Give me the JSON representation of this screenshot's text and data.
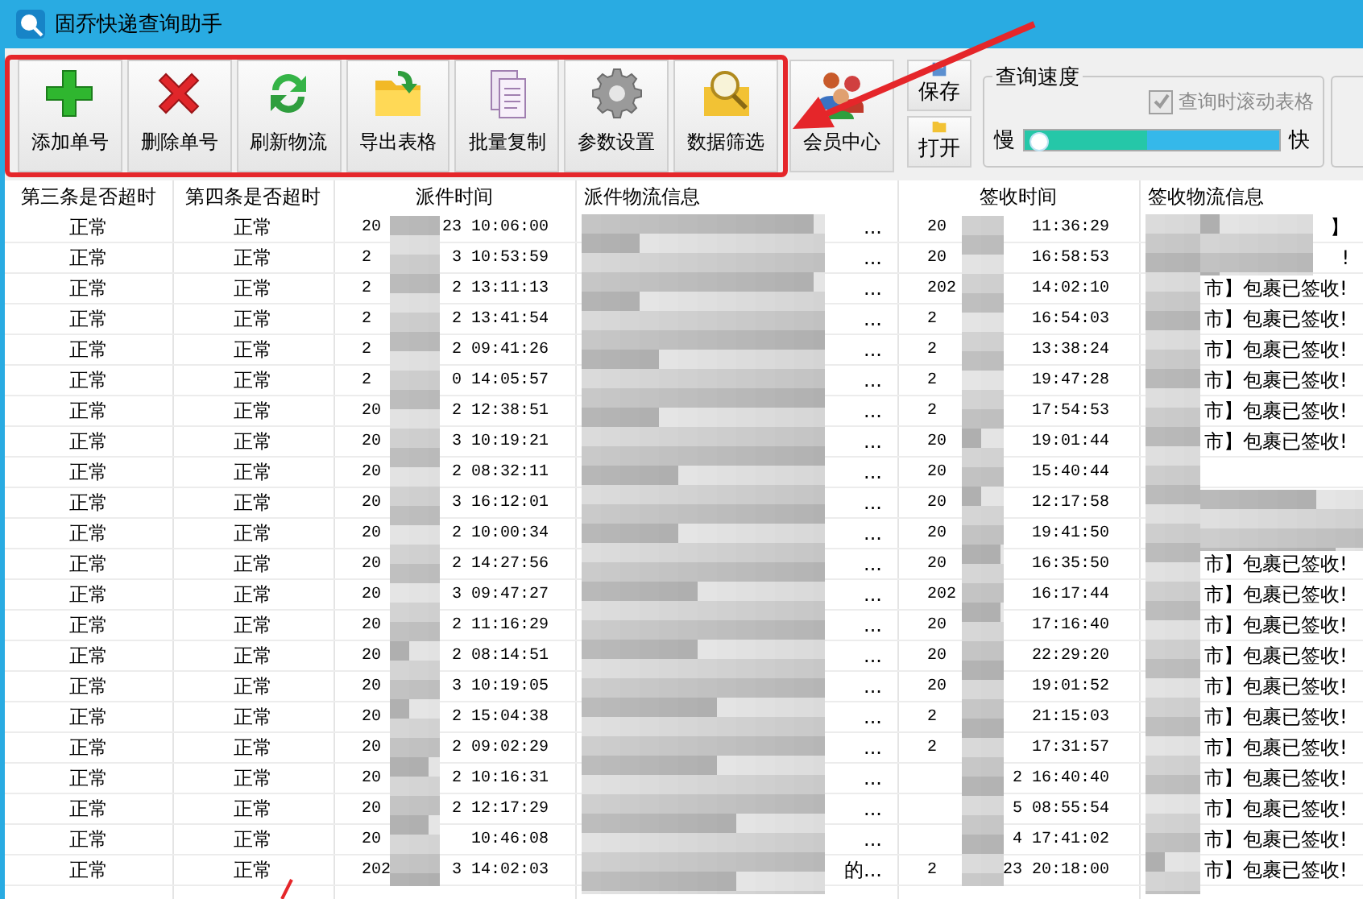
{
  "window": {
    "title": "固乔快递查询助手"
  },
  "toolbar": {
    "buttons": [
      {
        "label": "添加单号",
        "kind": "add"
      },
      {
        "label": "删除单号",
        "kind": "delete"
      },
      {
        "label": "刷新物流",
        "kind": "refresh"
      },
      {
        "label": "导出表格",
        "kind": "export"
      },
      {
        "label": "批量复制",
        "kind": "copy"
      },
      {
        "label": "参数设置",
        "kind": "settings"
      },
      {
        "label": "数据筛选",
        "kind": "filter"
      },
      {
        "label": "会员中心",
        "kind": "members"
      }
    ],
    "small_buttons": [
      {
        "label": "保存",
        "kind": "save"
      },
      {
        "label": "打开",
        "kind": "open"
      }
    ]
  },
  "speed_group": {
    "title": "查询速度",
    "scroll_checkbox": {
      "label": "查询时滚动表格",
      "checked": true,
      "disabled": true
    },
    "slow_label": "慢",
    "fast_label": "快",
    "slider": {
      "level": 0.06
    }
  },
  "table": {
    "columns": [
      "第三条是否超时",
      "第四条是否超时",
      "派件时间",
      "派件物流信息",
      "签收时间",
      "签收物流信息"
    ],
    "rows": [
      {
        "third": "正常",
        "fourth": "正常",
        "dispatch_start": "20",
        "dispatch_end": "23 10:06:00",
        "info_end": "...",
        "sign_start": "20",
        "sign_end": "11:36:29",
        "sign_info": {
          "text": "】",
          "kind": "tail"
        }
      },
      {
        "third": "正常",
        "fourth": "正常",
        "dispatch_start": "2",
        "dispatch_end": "3 10:53:59",
        "info_end": "...",
        "sign_start": "20",
        "sign_end": "16:58:53",
        "sign_info": {
          "text": "!",
          "kind": "tail"
        }
      },
      {
        "third": "正常",
        "fourth": "正常",
        "dispatch_start": "2",
        "dispatch_end": "2 13:11:13",
        "info_end": "...",
        "sign_start": "202",
        "sign_end": "14:02:10",
        "sign_info": {
          "text": "市】包裹已签收!",
          "kind": "head"
        }
      },
      {
        "third": "正常",
        "fourth": "正常",
        "dispatch_start": "2",
        "dispatch_end": "2 13:41:54",
        "info_end": "...",
        "sign_start": "2",
        "sign_end": "16:54:03",
        "sign_info": {
          "text": "市】包裹已签收!",
          "kind": "head"
        }
      },
      {
        "third": "正常",
        "fourth": "正常",
        "dispatch_start": "2",
        "dispatch_end": "2 09:41:26",
        "info_end": "...",
        "sign_start": "2",
        "sign_end": "13:38:24",
        "sign_info": {
          "text": "市】包裹已签收!",
          "kind": "head"
        }
      },
      {
        "third": "正常",
        "fourth": "正常",
        "dispatch_start": "2",
        "dispatch_end": "0 14:05:57",
        "info_end": "...",
        "sign_start": "2",
        "sign_end": "19:47:28",
        "sign_info": {
          "text": "市】包裹已签收!",
          "kind": "head"
        }
      },
      {
        "third": "正常",
        "fourth": "正常",
        "dispatch_start": "20",
        "dispatch_end": "2 12:38:51",
        "info_end": "...",
        "sign_start": "2",
        "sign_end": "17:54:53",
        "sign_info": {
          "text": "市】包裹已签收!",
          "kind": "head"
        }
      },
      {
        "third": "正常",
        "fourth": "正常",
        "dispatch_start": "20",
        "dispatch_end": "3 10:19:21",
        "info_end": "...",
        "sign_start": "20",
        "sign_end": "19:01:44",
        "sign_info": {
          "text": "市】包裹已签收!",
          "kind": "head"
        }
      },
      {
        "third": "正常",
        "fourth": "正常",
        "dispatch_start": "20",
        "dispatch_end": "2 08:32:11",
        "info_end": "...",
        "sign_start": "20",
        "sign_end": "15:40:44"
      },
      {
        "third": "正常",
        "fourth": "正常",
        "dispatch_start": "20",
        "dispatch_end": "3 16:12:01",
        "info_end": "...",
        "sign_start": "20",
        "sign_end": "12:17:58"
      },
      {
        "third": "正常",
        "fourth": "正常",
        "dispatch_start": "20",
        "dispatch_end": "2 10:00:34",
        "info_end": "...",
        "sign_start": "20",
        "sign_end": "19:41:50"
      },
      {
        "third": "正常",
        "fourth": "正常",
        "dispatch_start": "20",
        "dispatch_end": "2 14:27:56",
        "info_end": "...",
        "sign_start": "20",
        "sign_end": "16:35:50",
        "sign_info": {
          "text": "市】包裹已签收!",
          "kind": "head"
        }
      },
      {
        "third": "正常",
        "fourth": "正常",
        "dispatch_start": "20",
        "dispatch_end": "3 09:47:27",
        "info_end": "...",
        "sign_start": "202",
        "sign_end": "16:17:44",
        "sign_info": {
          "text": "市】包裹已签收!",
          "kind": "head"
        }
      },
      {
        "third": "正常",
        "fourth": "正常",
        "dispatch_start": "20",
        "dispatch_end": "2 11:16:29",
        "info_end": "...",
        "sign_start": "20",
        "sign_end": "17:16:40",
        "sign_info": {
          "text": "市】包裹已签收!",
          "kind": "head"
        }
      },
      {
        "third": "正常",
        "fourth": "正常",
        "dispatch_start": "20",
        "dispatch_end": "2 08:14:51",
        "info_end": "...",
        "sign_start": "20",
        "sign_end": "22:29:20",
        "sign_info": {
          "text": "市】包裹已签收!",
          "kind": "head"
        }
      },
      {
        "third": "正常",
        "fourth": "正常",
        "dispatch_start": "20",
        "dispatch_end": "3 10:19:05",
        "info_end": "...",
        "sign_start": "20",
        "sign_end": "19:01:52",
        "sign_info": {
          "text": "市】包裹已签收!",
          "kind": "head"
        }
      },
      {
        "third": "正常",
        "fourth": "正常",
        "dispatch_start": "20",
        "dispatch_end": "2 15:04:38",
        "info_end": "...",
        "sign_start": "2",
        "sign_end": "21:15:03",
        "sign_info": {
          "text": "市】包裹已签收!",
          "kind": "head"
        }
      },
      {
        "third": "正常",
        "fourth": "正常",
        "dispatch_start": "20",
        "dispatch_end": "2 09:02:29",
        "info_end": "...",
        "sign_start": "2",
        "sign_end": "17:31:57",
        "sign_info": {
          "text": "市】包裹已签收!",
          "kind": "head"
        }
      },
      {
        "third": "正常",
        "fourth": "正常",
        "dispatch_start": "20",
        "dispatch_end": "2 10:16:31",
        "info_end": "...",
        "sign_end": "2 16:40:40",
        "sign_info": {
          "text": "市】包裹已签收!",
          "kind": "head"
        }
      },
      {
        "third": "正常",
        "fourth": "正常",
        "dispatch_start": "20",
        "dispatch_end": "2 12:17:29",
        "info_end": "...",
        "sign_end": "5 08:55:54",
        "sign_info": {
          "text": "市】包裹已签收!",
          "kind": "head"
        }
      },
      {
        "third": "正常",
        "fourth": "正常",
        "dispatch_start": "20",
        "dispatch_end": "10:46:08",
        "info_end": "...",
        "sign_end": "4 17:41:02",
        "sign_info": {
          "text": "市】包裹已签收!",
          "kind": "head"
        }
      },
      {
        "third": "正常",
        "fourth": "正常",
        "dispatch_start": "202",
        "dispatch_end": "3 14:02:03",
        "info_end": "的...",
        "sign_start": "2",
        "sign_end": "23 20:18:00",
        "sign_info": {
          "text": "市】包裹已签收!",
          "kind": "head"
        }
      }
    ]
  }
}
